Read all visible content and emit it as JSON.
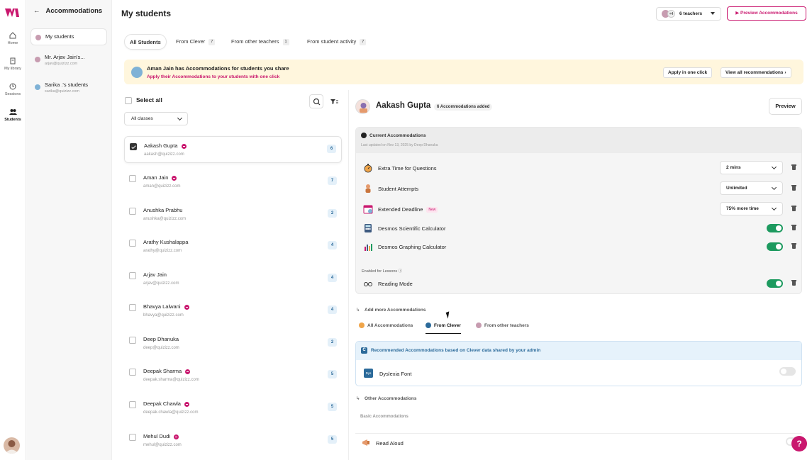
{
  "rail": {
    "items": [
      {
        "label": "Home",
        "icon": "home-icon"
      },
      {
        "label": "My library",
        "icon": "library-icon"
      },
      {
        "label": "Sessions",
        "icon": "sessions-icon"
      },
      {
        "label": "Students",
        "icon": "students-icon"
      }
    ]
  },
  "sidebar": {
    "title": "Accommodations",
    "items": [
      {
        "name": "My students",
        "email": ""
      },
      {
        "name": "Mr. Arjav Jain's...",
        "email": "arjav@quizizz.com"
      },
      {
        "name": "Sarika .'s students",
        "email": "sarika@quizizz.com"
      }
    ]
  },
  "header": {
    "title": "My students",
    "teachers_count": "+4",
    "teachers_label": "6 teachers",
    "preview_label": "▶ Preview Accommodations"
  },
  "tabs": [
    {
      "label": "All Students",
      "count": ""
    },
    {
      "label": "From Clever",
      "count": "7"
    },
    {
      "label": "From other teachers",
      "count": "1"
    },
    {
      "label": "From student activity",
      "count": "7"
    }
  ],
  "banner": {
    "title": "Aman Jain has Accommodations for students you share",
    "subtitle": "Apply their Accommodations to your students with one click",
    "apply_label": "Apply in one click",
    "view_label": "View all recommendations ›"
  },
  "list": {
    "select_all": "Select all",
    "classes_label": "All classes",
    "students": [
      {
        "name": "Aakash Gupta",
        "email": "aakash@quizizz.com",
        "count": "6"
      },
      {
        "name": "Aman Jain",
        "email": "aman@quizizz.com",
        "count": "7"
      },
      {
        "name": "Anushka Prabhu",
        "email": "anushka@quizizz.com",
        "count": "2"
      },
      {
        "name": "Arathy Kushalappa",
        "email": "arathy@quizizz.com",
        "count": "4"
      },
      {
        "name": "Arjav Jain",
        "email": "arjav@quizizz.com",
        "count": "4"
      },
      {
        "name": "Bhavya Lalwani",
        "email": "bhavya@quizizz.com",
        "count": "4"
      },
      {
        "name": "Deep Dhanuka",
        "email": "deep@quizizz.com",
        "count": "2"
      },
      {
        "name": "Deepak Sharma",
        "email": "deepak.sharma@quizizz.com",
        "count": "5"
      },
      {
        "name": "Deepak Chawla",
        "email": "deepak.chawla@quizizz.com",
        "count": "5"
      },
      {
        "name": "Mehul Dudi",
        "email": "mehul@quizizz.com",
        "count": "5"
      }
    ]
  },
  "panel": {
    "student_name": "Aakash Gupta",
    "added_badge": "6 Accommodations added",
    "preview_label": "Preview",
    "current_title": "Current Accommodations",
    "current_sub": "Last updated on Nov 13, 2025 by Deep Dhanuka",
    "accommodations": [
      {
        "label": "Extra Time for Questions",
        "value": "2 mins",
        "new": ""
      },
      {
        "label": "Student Attempts",
        "value": "Unlimited",
        "new": ""
      },
      {
        "label": "Extended Deadline",
        "value": "75% more time",
        "new": "New"
      },
      {
        "label": "Desmos Scientific Calculator",
        "value": "",
        "new": ""
      },
      {
        "label": "Desmos Graphing Calculator",
        "value": "",
        "new": ""
      }
    ],
    "enabled_lessons": "Enabled for Lessons ⓘ",
    "reading_mode": "Reading Mode",
    "add_more": "Add more Accommodations",
    "subtabs": [
      {
        "label": "All Accommodations",
        "color": "#f0a54a"
      },
      {
        "label": "From Clever",
        "color": "#2b6a9a"
      },
      {
        "label": "From other teachers",
        "color": "#c79cb0"
      }
    ],
    "clever_title": "Recommended Accommodations based on Clever data shared by your admin",
    "clever_icon": "C",
    "dyslexia_icon": "Dys",
    "dyslexia_label": "Dyslexia Font",
    "other_title": "Other Accommodations",
    "basic_title": "Basic Accommodations",
    "read_aloud": "Read Aloud"
  },
  "help": "?",
  "colors": {
    "brand": "#c9176e",
    "toggle_on": "#1d9a5f",
    "clever": "#2b6a9a"
  }
}
